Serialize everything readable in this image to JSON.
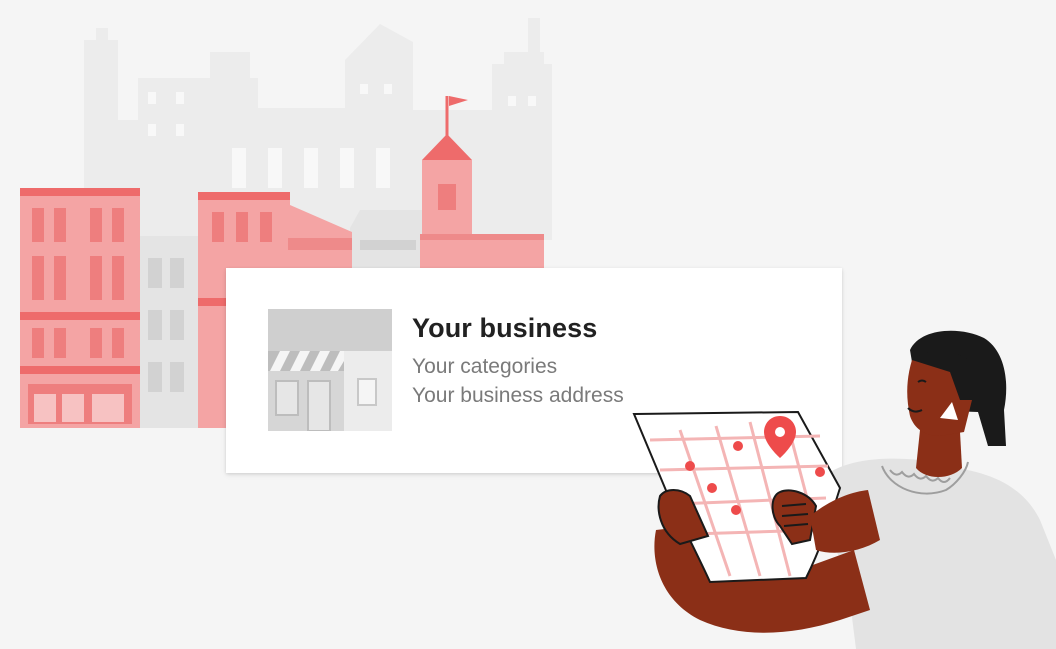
{
  "card": {
    "title": "Your business",
    "categories": "Your categories",
    "address": "Your business address"
  },
  "colors": {
    "background": "#f5f5f5",
    "brand_red": "#ee6b6b",
    "red_light": "#f4a4a4",
    "gray_building": "#e2e2e2",
    "gray_building_dark": "#cfcfcf",
    "skin": "#8b2f17",
    "hair": "#1a1a1a",
    "shirt": "#e3e3e3"
  },
  "icons": {
    "storefront": "storefront-icon",
    "map_pin": "map-pin-icon",
    "flag": "flag-icon"
  }
}
